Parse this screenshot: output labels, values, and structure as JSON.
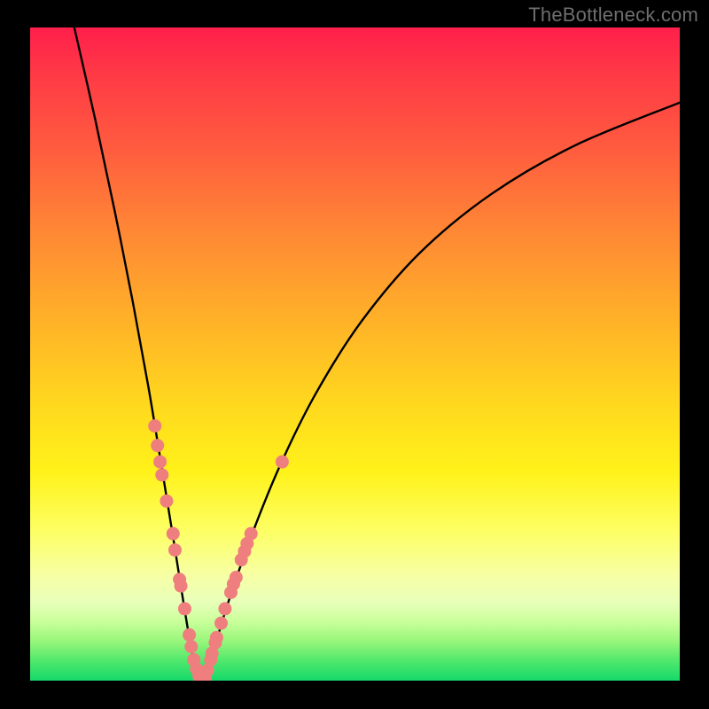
{
  "watermark": "TheBottleneck.com",
  "chart_data": {
    "type": "line",
    "title": "",
    "xlabel": "",
    "ylabel": "",
    "xlim": [
      0,
      100
    ],
    "ylim": [
      0,
      100
    ],
    "grid": false,
    "legend": false,
    "background_gradient": {
      "orientation": "vertical",
      "stops": [
        {
          "pos": 0.0,
          "color": "#ff1f4b"
        },
        {
          "pos": 0.45,
          "color": "#ffb228"
        },
        {
          "pos": 0.77,
          "color": "#fdff63"
        },
        {
          "pos": 1.0,
          "color": "#16d96a"
        }
      ]
    },
    "series": [
      {
        "name": "left-branch",
        "style": "line",
        "color": "#000000",
        "points": [
          {
            "x": 6.8,
            "y": 100.0
          },
          {
            "x": 10.0,
            "y": 86.0
          },
          {
            "x": 13.0,
            "y": 72.0
          },
          {
            "x": 15.8,
            "y": 58.0
          },
          {
            "x": 18.2,
            "y": 45.0
          },
          {
            "x": 20.2,
            "y": 33.0
          },
          {
            "x": 22.0,
            "y": 22.0
          },
          {
            "x": 23.6,
            "y": 12.0
          },
          {
            "x": 25.0,
            "y": 4.0
          },
          {
            "x": 26.3,
            "y": 0.0
          }
        ]
      },
      {
        "name": "right-branch",
        "style": "line",
        "color": "#000000",
        "points": [
          {
            "x": 26.3,
            "y": 0.0
          },
          {
            "x": 28.0,
            "y": 4.0
          },
          {
            "x": 30.5,
            "y": 12.0
          },
          {
            "x": 34.0,
            "y": 22.0
          },
          {
            "x": 38.5,
            "y": 33.0
          },
          {
            "x": 44.0,
            "y": 44.0
          },
          {
            "x": 51.0,
            "y": 55.0
          },
          {
            "x": 60.0,
            "y": 65.5
          },
          {
            "x": 71.0,
            "y": 74.5
          },
          {
            "x": 84.0,
            "y": 82.0
          },
          {
            "x": 100.0,
            "y": 88.5
          }
        ]
      },
      {
        "name": "markers",
        "style": "scatter",
        "color": "#ef7f7e",
        "points": [
          {
            "x": 19.2,
            "y": 39.0
          },
          {
            "x": 19.6,
            "y": 36.0
          },
          {
            "x": 20.0,
            "y": 33.5
          },
          {
            "x": 20.3,
            "y": 31.5
          },
          {
            "x": 21.0,
            "y": 27.5
          },
          {
            "x": 22.0,
            "y": 22.5
          },
          {
            "x": 22.3,
            "y": 20.0
          },
          {
            "x": 23.0,
            "y": 15.5
          },
          {
            "x": 23.2,
            "y": 14.5
          },
          {
            "x": 23.8,
            "y": 11.0
          },
          {
            "x": 24.5,
            "y": 7.0
          },
          {
            "x": 24.8,
            "y": 5.2
          },
          {
            "x": 25.2,
            "y": 3.2
          },
          {
            "x": 25.6,
            "y": 1.8
          },
          {
            "x": 26.0,
            "y": 0.7
          },
          {
            "x": 26.4,
            "y": 0.0
          },
          {
            "x": 26.9,
            "y": 0.4
          },
          {
            "x": 27.3,
            "y": 1.6
          },
          {
            "x": 27.8,
            "y": 3.2
          },
          {
            "x": 28.0,
            "y": 4.2
          },
          {
            "x": 28.5,
            "y": 5.8
          },
          {
            "x": 28.7,
            "y": 6.6
          },
          {
            "x": 29.4,
            "y": 8.8
          },
          {
            "x": 30.0,
            "y": 11.0
          },
          {
            "x": 30.9,
            "y": 13.5
          },
          {
            "x": 31.3,
            "y": 14.8
          },
          {
            "x": 31.7,
            "y": 15.8
          },
          {
            "x": 32.5,
            "y": 18.5
          },
          {
            "x": 33.0,
            "y": 19.8
          },
          {
            "x": 33.4,
            "y": 21.0
          },
          {
            "x": 34.0,
            "y": 22.5
          },
          {
            "x": 38.8,
            "y": 33.5
          }
        ]
      }
    ]
  }
}
